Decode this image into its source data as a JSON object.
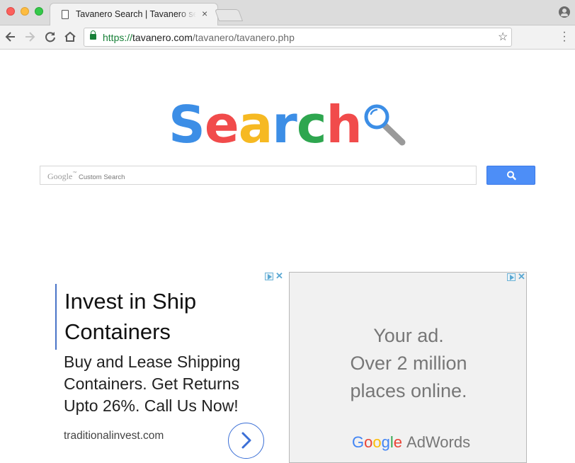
{
  "browser": {
    "tab_title": "Tavanero Search | Tavanero search",
    "tab_close": "×",
    "url_scheme": "https://",
    "url_host": "tavanero.com",
    "url_path": "/tavanero/tavanero.php",
    "icons": [
      "back-arrow-icon",
      "forward-arrow-icon",
      "reload-icon",
      "home-icon",
      "lock-icon",
      "star-icon",
      "menu-dots-icon",
      "profile-icon",
      "page-icon",
      "close-icon"
    ]
  },
  "logo": {
    "letters": [
      {
        "char": "S",
        "color": "#3c8ee6"
      },
      {
        "char": "e",
        "color": "#f14b4b"
      },
      {
        "char": "a",
        "color": "#f6b922"
      },
      {
        "char": "r",
        "color": "#3c8ee6"
      },
      {
        "char": "c",
        "color": "#2ea64f"
      },
      {
        "char": "h",
        "color": "#f14b4b"
      }
    ],
    "magnifier_colors": {
      "lens": "#3c8ee6",
      "handle": "#9a9a9a"
    }
  },
  "search": {
    "google_label": "Google",
    "tm": "™",
    "placeholder": "Custom Search",
    "button_color": "#4d8ef7"
  },
  "ad_left": {
    "headline_1": "Invest in Ship",
    "headline_2": "Containers",
    "body": "Buy and Lease Shipping Containers. Get Returns Upto 26%. Call Us Now!",
    "domain": "traditionalinvest.com",
    "accent": "#4a74c8"
  },
  "ad_right": {
    "line_1": "Your ad.",
    "line_2": "Over 2 million",
    "line_3": "places online.",
    "brand_google": "Google",
    "brand_product": "AdWords",
    "google_colors": [
      "#4285f4",
      "#ea4335",
      "#fbbc05",
      "#4285f4",
      "#34a853",
      "#ea4335"
    ]
  }
}
